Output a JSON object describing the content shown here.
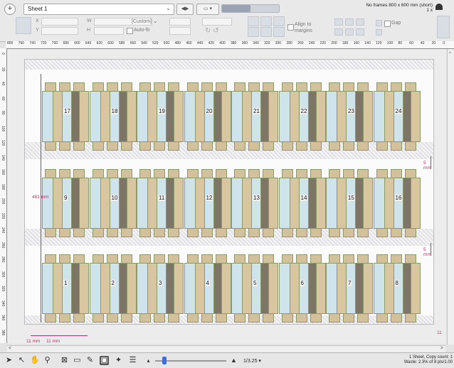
{
  "toolbar": {
    "add_label": "+",
    "sheet_name": "Sheet 1",
    "prev_label": "◀",
    "next_label": "▶",
    "view_label": "▭ ▾",
    "x_label": "X",
    "y_label": "Y",
    "w_label": "W",
    "h_label": "H",
    "preset_value": "[Custom]",
    "autofit_label": "Auto-fit",
    "align_label": "Align to margins",
    "gap_label": "Gap",
    "frame_info": "No frames 800 x 600 mm (short)",
    "frame_count": "1 x"
  },
  "ruler": {
    "ticks": [
      "800",
      "760",
      "740",
      "720",
      "700",
      "680",
      "660",
      "640",
      "620",
      "600",
      "580",
      "560",
      "540",
      "520",
      "500",
      "480",
      "460",
      "440",
      "420",
      "400",
      "380",
      "360",
      "340",
      "320",
      "300",
      "280",
      "260",
      "240",
      "220",
      "200",
      "180",
      "160",
      "140",
      "120",
      "100",
      "80",
      "60",
      "40",
      "20",
      "0"
    ],
    "left_ticks": [
      "0",
      "20",
      "40",
      "60",
      "80",
      "100",
      "120",
      "140",
      "160",
      "180",
      "200",
      "220",
      "240",
      "260",
      "280",
      "300",
      "320",
      "340",
      "360",
      "380"
    ]
  },
  "canvas": {
    "rows": [
      [
        "17",
        "18",
        "19",
        "20",
        "21",
        "22",
        "23",
        "24"
      ],
      [
        "9",
        "10",
        "11",
        "12",
        "13",
        "14",
        "15",
        "16"
      ],
      [
        "1",
        "2",
        "3",
        "4",
        "5",
        "6",
        "7",
        "8"
      ]
    ],
    "dim_481": "481 mm",
    "dim_5mm_top": "5 mm",
    "dim_5mm_bottom": "5 mm",
    "dim_11mm_left": "11 mm",
    "dim_11mm_right": "11 mm",
    "dim_11_edge": "11"
  },
  "bottom": {
    "zoom": "1/3.25 ▾",
    "status_line1": "1 Sheet, Copy count: 1",
    "status_line2": "Waste: 2.3% of 8 pls/1.00"
  },
  "colors": {
    "accent": "#c0306a",
    "panel_blue": "#cfe3ea",
    "panel_tan": "#d8c6a1"
  }
}
